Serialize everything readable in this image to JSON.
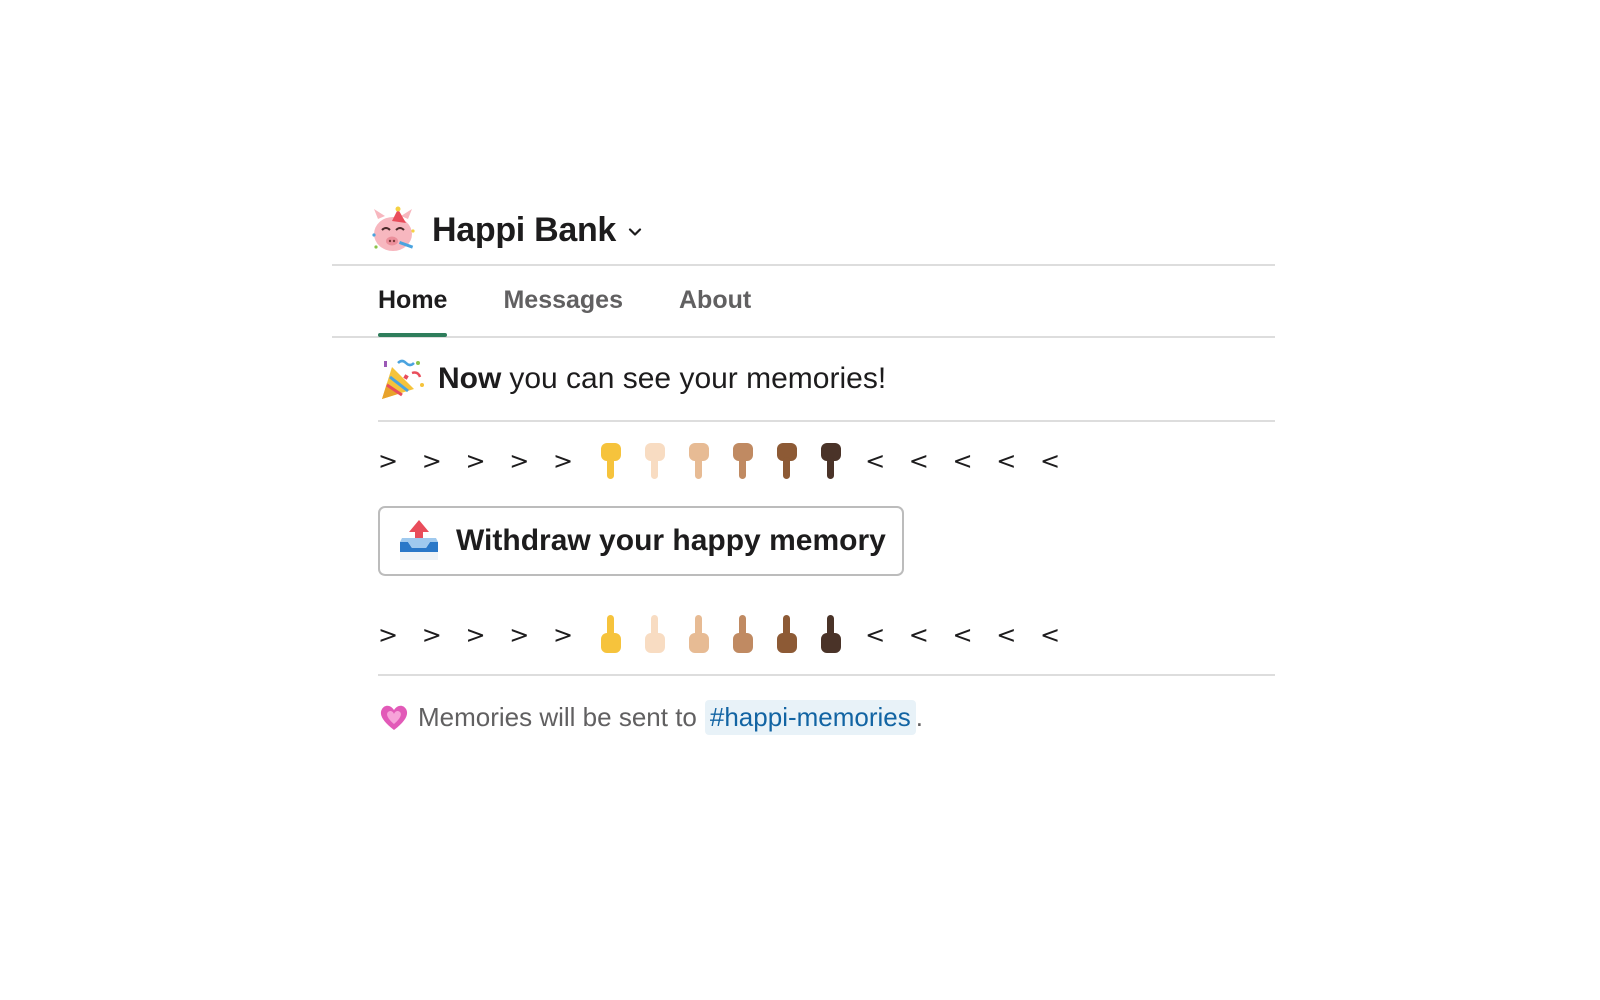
{
  "app": {
    "avatar_icon": "party-pig-icon",
    "name": "Happi Bank"
  },
  "tabs": [
    {
      "label": "Home",
      "active": true
    },
    {
      "label": "Messages",
      "active": false
    },
    {
      "label": "About",
      "active": false
    }
  ],
  "home": {
    "headline_icon": "party-popper-icon",
    "headline_bold": "Now",
    "headline_rest": "you can see your memories!",
    "top_row": {
      "left_arrows": "> > > > >",
      "right_arrows": "< < < < <",
      "icons": [
        "pointing-down-icon",
        "pointing-down-icon",
        "pointing-down-icon",
        "pointing-down-icon",
        "pointing-down-icon",
        "pointing-down-icon"
      ]
    },
    "withdraw_button": {
      "icon": "outbox-tray-icon",
      "label": "Withdraw your happy memory"
    },
    "bottom_row": {
      "left_arrows": "> > > > >",
      "right_arrows": "< < < < <",
      "icons": [
        "pointing-up-icon",
        "pointing-up-icon",
        "pointing-up-icon",
        "pointing-up-icon",
        "pointing-up-icon",
        "pointing-up-icon"
      ]
    },
    "footer": {
      "icon": "growing-heart-icon",
      "text": "Memories will be sent to",
      "channel": "#happi-memories",
      "suffix": "."
    }
  },
  "colors": {
    "tab_underline": "#2e7d5b",
    "channel_link": "#1264a3",
    "channel_bg": "#e8f2f8",
    "skin_tones": [
      "#f6c33c",
      "#f8dcc2",
      "#e7bb94",
      "#c08a62",
      "#8d5a35",
      "#4a3328"
    ]
  }
}
